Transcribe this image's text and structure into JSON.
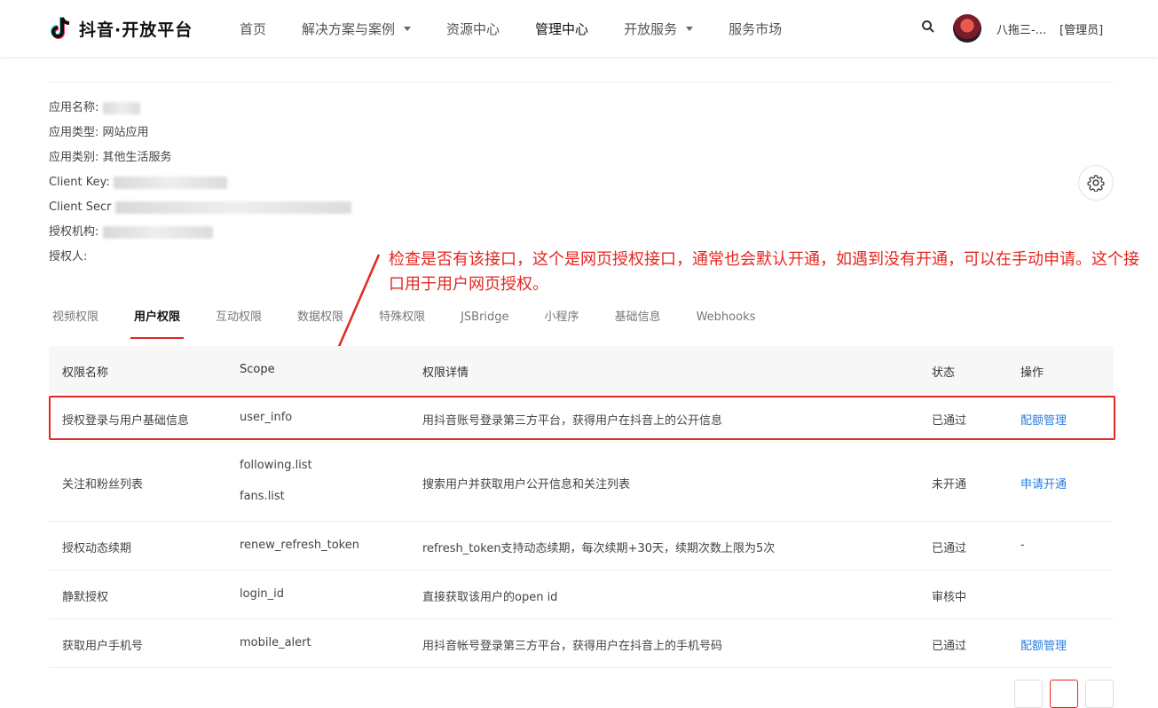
{
  "header": {
    "logo_text": "抖音·开放平台",
    "nav": [
      {
        "label": "首页",
        "has_caret": false,
        "active": false
      },
      {
        "label": "解决方案与案例",
        "has_caret": true,
        "active": false
      },
      {
        "label": "资源中心",
        "has_caret": false,
        "active": false
      },
      {
        "label": "管理中心",
        "has_caret": false,
        "active": true
      },
      {
        "label": "开放服务",
        "has_caret": true,
        "active": false
      },
      {
        "label": "服务市场",
        "has_caret": false,
        "active": false
      }
    ],
    "user_name": "八拖三-...",
    "user_role": "[管理员]"
  },
  "app_info": {
    "name_label": "应用名称:",
    "type_label": "应用类型:",
    "type_value": "网站应用",
    "category_label": "应用类别:",
    "category_value": "其他生活服务",
    "client_key_label": "Client Key:",
    "client_secret_label": "Client Secr",
    "org_label": "授权机构:",
    "person_label": "授权人:"
  },
  "annotation": "检查是否有该接口，这个是网页授权接口，通常也会默认开通，如遇到没有开通，可以在手动申请。这个接口用于用户网页授权。",
  "tabs": [
    "视频权限",
    "用户权限",
    "互动权限",
    "数据权限",
    "特殊权限",
    "JSBridge",
    "小程序",
    "基础信息",
    "Webhooks"
  ],
  "active_tab": "用户权限",
  "table": {
    "headers": [
      "权限名称",
      "Scope",
      "权限详情",
      "状态",
      "操作"
    ],
    "rows": [
      {
        "name": "授权登录与用户基础信息",
        "scope": [
          "user_info"
        ],
        "detail": "用抖音账号登录第三方平台，获得用户在抖音上的公开信息",
        "status": "已通过",
        "action": "配额管理"
      },
      {
        "name": "关注和粉丝列表",
        "scope": [
          "following.list",
          "fans.list"
        ],
        "detail": "搜索用户并获取用户公开信息和关注列表",
        "status": "未开通",
        "action": "申请开通"
      },
      {
        "name": "授权动态续期",
        "scope": [
          "renew_refresh_token"
        ],
        "detail": "refresh_token支持动态续期，每次续期+30天，续期次数上限为5次",
        "status": "已通过",
        "action": "-"
      },
      {
        "name": "静默授权",
        "scope": [
          "login_id"
        ],
        "detail": "直接获取该用户的open id",
        "status": "审核中",
        "action": ""
      },
      {
        "name": "获取用户手机号",
        "scope": [
          "mobile_alert"
        ],
        "detail": "用抖音帐号登录第三方平台，获得用户在抖音上的手机号码",
        "status": "已通过",
        "action": "配额管理"
      }
    ]
  },
  "colors": {
    "accent": "#e5261f",
    "link": "#2a7de1"
  }
}
